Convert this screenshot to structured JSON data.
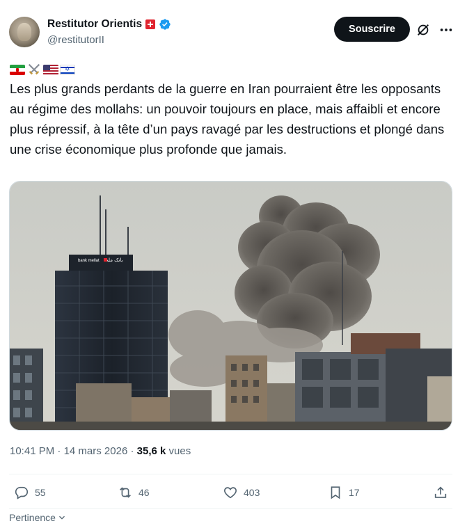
{
  "author": {
    "display_name": "Restitutor Orientis",
    "handle": "@restitutorII",
    "verified": true,
    "badge": "swiss-flag"
  },
  "header": {
    "subscribe_label": "Souscrire"
  },
  "tweet": {
    "emoji_flags": [
      "iran-flag",
      "crossed-swords",
      "us-flag",
      "israel-flag"
    ],
    "text": "Les plus grands perdants de la guerre en Iran pourraient être les opposants au régime des mollahs: un pouvoir toujours en place, mais affaibli et encore plus répressif, à la tête d’un pays ravagé par les destructions et plongé dans une crise économique plus profonde que jamais.",
    "image": {
      "sign_text_latin": "bank mellat",
      "sign_text_farsi": "بانک ملت"
    },
    "time": "10:41 PM",
    "date": "14 mars 2026",
    "views_count": "35,6 k",
    "views_label": "vues"
  },
  "actions": {
    "replies": "55",
    "reposts": "46",
    "likes": "403",
    "bookmarks": "17"
  },
  "footer": {
    "sort_label": "Pertinence"
  },
  "colors": {
    "text_primary": "#0f1419",
    "text_secondary": "#536471",
    "verified_blue": "#1d9bf0",
    "button_dark": "#0f1419",
    "divider": "#eff3f4"
  }
}
